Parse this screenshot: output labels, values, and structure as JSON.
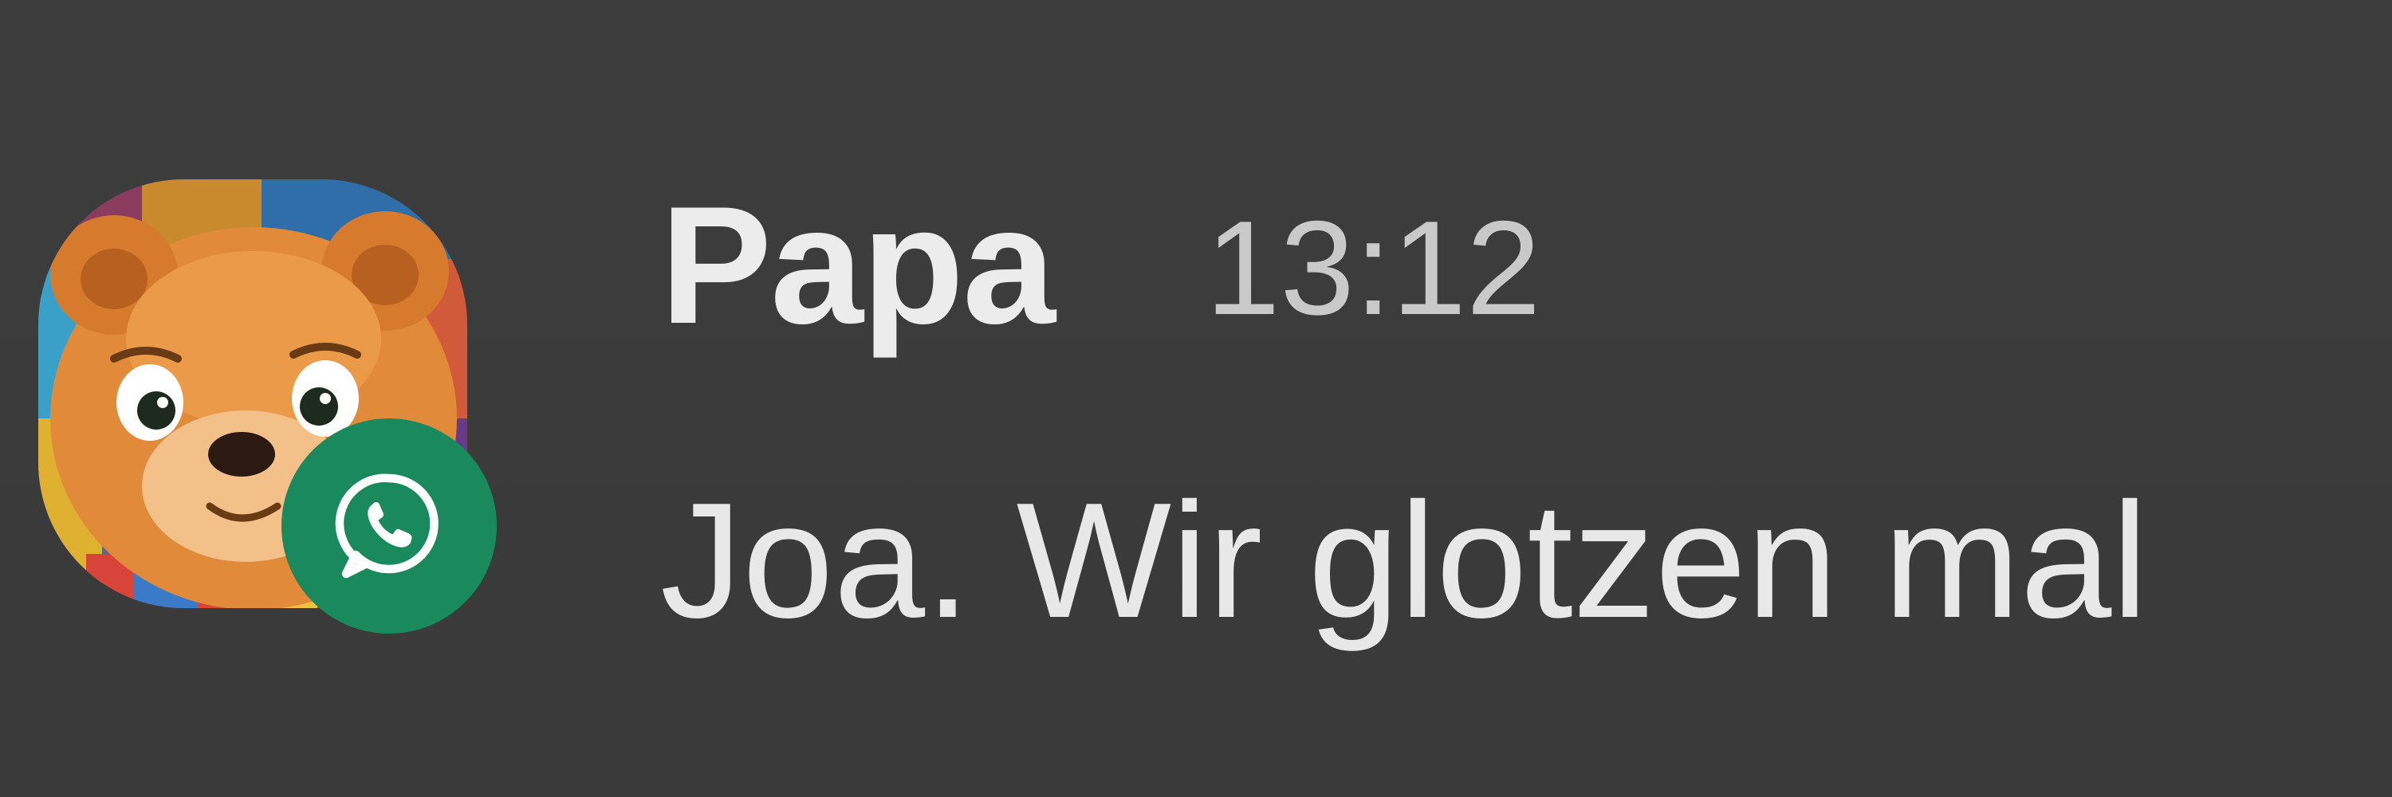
{
  "notification": {
    "sender": "Papa",
    "time": "13:12",
    "message": "Joa. Wir glotzen mal"
  },
  "app_badge": {
    "icon": "whatsapp-icon",
    "color": "#1a8a5e"
  },
  "avatar": {
    "icon": "teddy-bear-avatar"
  },
  "colors": {
    "background": "#3b3b3b",
    "text_primary": "#ececec",
    "text_secondary": "#c9c9c9"
  }
}
